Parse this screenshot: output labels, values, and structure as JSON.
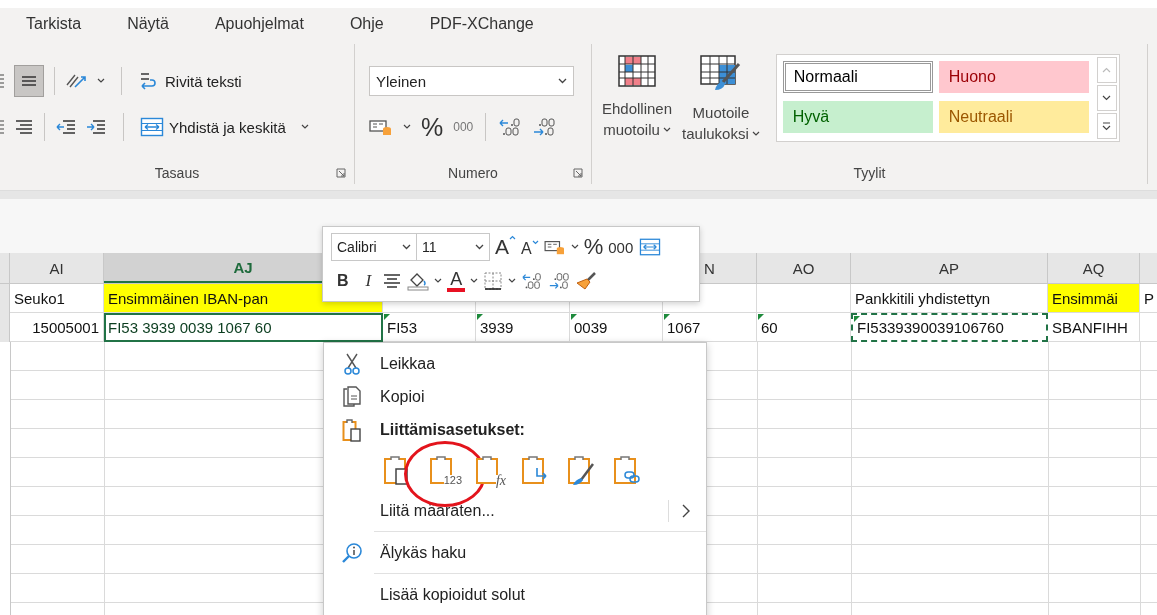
{
  "menu_tabs": [
    {
      "label": "Tarkista",
      "selected": false
    },
    {
      "label": "Näytä",
      "selected": false
    },
    {
      "label": "Apuohjelmat",
      "selected": false
    },
    {
      "label": "Ohje",
      "selected": false
    },
    {
      "label": "PDF-XChange",
      "selected": false
    }
  ],
  "ribbon": {
    "alignment": {
      "middle_align_on": true,
      "wrap_text": "Rivitä teksti",
      "merge_center": "Yhdistä ja keskitä",
      "label": "Tasaus"
    },
    "number": {
      "format": "Yleinen",
      "percent": "%",
      "thousands": "000",
      "label": "Numero"
    },
    "styles": {
      "conditional_formatting": [
        "Ehdollinen",
        "muotoilu"
      ],
      "format_as_table": [
        "Muotoile",
        "taulukoksi"
      ],
      "label": "Tyylit",
      "gallery": [
        {
          "label": "Normaali",
          "kind": "normal",
          "selected": true
        },
        {
          "label": "Huono",
          "kind": "bad",
          "selected": false
        },
        {
          "label": "Hyvä",
          "kind": "good",
          "selected": false
        },
        {
          "label": "Neutraali",
          "kind": "neutral",
          "selected": false
        }
      ]
    }
  },
  "sheet": {
    "columns": [
      {
        "label": "AI",
        "selected": false
      },
      {
        "label": "AJ",
        "selected": true
      },
      {},
      {},
      {},
      {
        "label": "N",
        "selected": false
      },
      {
        "label": "AO",
        "selected": false
      },
      {
        "label": "AP",
        "selected": false
      },
      {
        "label": "AQ",
        "selected": false
      },
      {}
    ],
    "rows": [
      {
        "cells": [
          {
            "text": "Seuko1",
            "kind": "text",
            "highlight": false,
            "selected": false,
            "copied": false,
            "error_flag": false
          },
          {
            "text": "Ensimmäinen IBAN-pan",
            "kind": "text",
            "highlight": true,
            "selected": false,
            "copied": false,
            "error_flag": false
          },
          {},
          {},
          {},
          {},
          {},
          {
            "text": "Pankkitili yhdistettyn",
            "kind": "text",
            "highlight": false,
            "selected": false,
            "copied": false,
            "error_flag": false
          },
          {
            "text": "Ensimmäi",
            "kind": "text",
            "highlight": true,
            "selected": false,
            "copied": false,
            "error_flag": false
          },
          {
            "text": "P",
            "kind": "text",
            "highlight": false,
            "selected": false,
            "copied": false,
            "error_flag": false
          }
        ]
      },
      {
        "cells": [
          {
            "text": "15005001",
            "kind": "number",
            "highlight": false,
            "selected": false,
            "copied": false,
            "error_flag": false
          },
          {
            "text": "FI53 3939 0039 1067 60",
            "kind": "text",
            "highlight": false,
            "selected": true,
            "copied": false,
            "error_flag": false
          },
          {
            "text": "FI53",
            "kind": "text",
            "highlight": false,
            "selected": false,
            "copied": false,
            "error_flag": true
          },
          {
            "text": "3939",
            "kind": "text",
            "highlight": false,
            "selected": false,
            "copied": false,
            "error_flag": true
          },
          {
            "text": "0039",
            "kind": "text",
            "highlight": false,
            "selected": false,
            "copied": false,
            "error_flag": true
          },
          {
            "text": "1067",
            "kind": "text",
            "highlight": false,
            "selected": false,
            "copied": false,
            "error_flag": true
          },
          {
            "text": "60",
            "kind": "text",
            "highlight": false,
            "selected": false,
            "copied": false,
            "error_flag": true
          },
          {
            "text": "FI5339390039106760",
            "kind": "text",
            "highlight": false,
            "selected": false,
            "copied": true,
            "error_flag": true
          },
          {
            "text": "SBANFIHH",
            "kind": "text",
            "highlight": false,
            "selected": false,
            "copied": false,
            "error_flag": false
          },
          {}
        ]
      }
    ]
  },
  "mini_toolbar": {
    "font": "Calibri",
    "size": "11",
    "grow_font": "A",
    "shrink_font": "A",
    "percent": "%",
    "thousands": "000",
    "bold": "B",
    "italic": "I",
    "font_color": "A"
  },
  "context_menu": {
    "items": [
      {
        "kind": "cut",
        "label": "Leikkaa"
      },
      {
        "kind": "copy",
        "label": "Kopioi"
      },
      {
        "kind": "paste-heading",
        "label": "Liittämisasetukset:"
      },
      {
        "kind": "paste-options",
        "options": [
          {
            "kind": "keep",
            "circled": false
          },
          {
            "kind": "values",
            "badge": "123",
            "circled": true
          },
          {
            "kind": "formulas",
            "badge": "fx",
            "circled": false
          },
          {
            "kind": "transpose",
            "circled": false
          },
          {
            "kind": "formatting",
            "circled": false
          },
          {
            "kind": "link",
            "circled": false
          }
        ]
      },
      {
        "kind": "submenu",
        "label": "Liitä määräten..."
      },
      {
        "kind": "separator"
      },
      {
        "kind": "smart-lookup",
        "label": "Älykäs haku"
      },
      {
        "kind": "separator"
      },
      {
        "kind": "plain",
        "label": "Lisää kopioidut solut"
      }
    ]
  }
}
